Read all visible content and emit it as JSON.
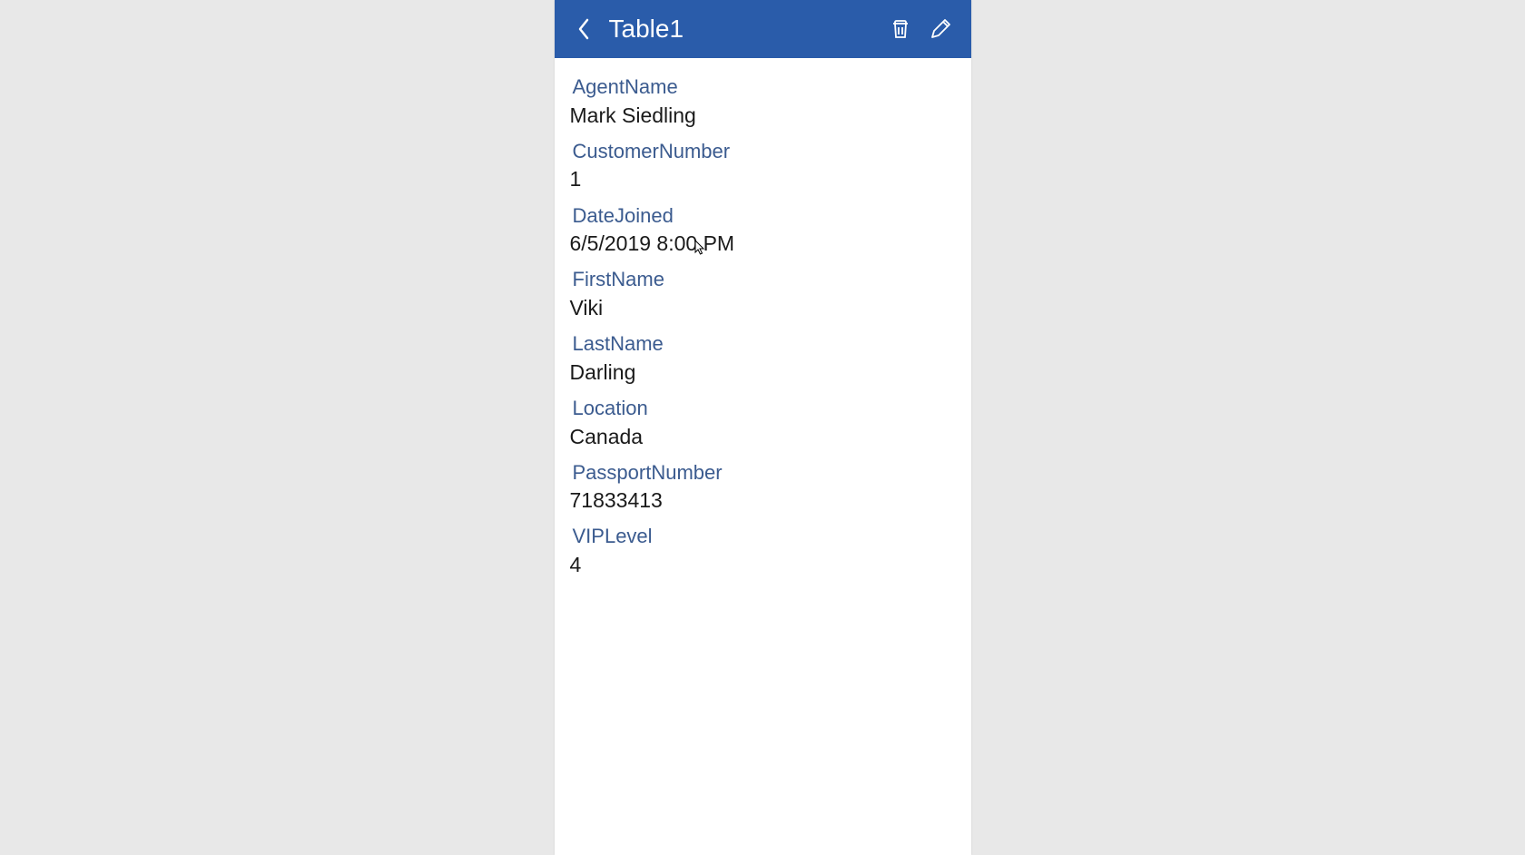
{
  "header": {
    "title": "Table1"
  },
  "fields": [
    {
      "label": "AgentName",
      "value": "Mark Siedling"
    },
    {
      "label": "CustomerNumber",
      "value": "1"
    },
    {
      "label": "DateJoined",
      "value": "6/5/2019 8:00 PM"
    },
    {
      "label": "FirstName",
      "value": "Viki"
    },
    {
      "label": "LastName",
      "value": "Darling"
    },
    {
      "label": "Location",
      "value": "Canada"
    },
    {
      "label": "PassportNumber",
      "value": "71833413"
    },
    {
      "label": "VIPLevel",
      "value": "4"
    }
  ]
}
